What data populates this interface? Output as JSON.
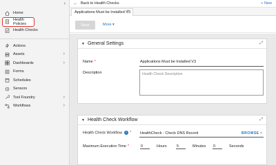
{
  "sidebar": {
    "collapse_icon": "chevron-left-icon",
    "top_items": [
      {
        "label": "Home",
        "icon": "home-icon"
      },
      {
        "label": "Health Policies",
        "icon": "document-icon",
        "active": true
      },
      {
        "label": "Health Checks",
        "icon": "checklist-icon"
      }
    ],
    "items": [
      {
        "label": "Actions",
        "icon": "bolt-icon",
        "expandable": false
      },
      {
        "label": "Assets",
        "icon": "server-icon",
        "expandable": true
      },
      {
        "label": "Dashboards",
        "icon": "dashboard-icon",
        "expandable": true
      },
      {
        "label": "Forms",
        "icon": "form-icon",
        "expandable": false
      },
      {
        "label": "Schedules",
        "icon": "calendar-icon",
        "expandable": false
      },
      {
        "label": "Sensors",
        "icon": "sensor-icon",
        "expandable": false
      },
      {
        "label": "Tool Foundry",
        "icon": "wrench-icon",
        "expandable": true
      },
      {
        "label": "Workflows",
        "icon": "workflow-icon",
        "expandable": true
      }
    ]
  },
  "topbar": {
    "back_label": "Back to Health Checks",
    "new_label": "+ New"
  },
  "tab": {
    "label": "Applications Must be Installed V3",
    "close": "×"
  },
  "actions": {
    "save_label": "Save",
    "more_label": "More ▾"
  },
  "general": {
    "title": "General Settings",
    "name_label": "Name",
    "name_value": "Applications Must be Installed V3",
    "description_label": "Description",
    "description_placeholder": "Health Check Description"
  },
  "workflow": {
    "title": "Health Check Workflow",
    "workflow_label": "Health Check Workflow",
    "workflow_value": "HealthCheck - Check DNS Record",
    "browse_label": "BROWSE",
    "exec_label": "Maximum Execution Time",
    "hours_value": "0",
    "hours_label": "Hours",
    "minutes_value": "5",
    "minutes_label": "Minutes",
    "seconds_value": "0",
    "seconds_label": "Seconds"
  },
  "colors": {
    "accent": "#1a73c9",
    "active_outline": "#d9342b",
    "required": "#d9342b"
  }
}
